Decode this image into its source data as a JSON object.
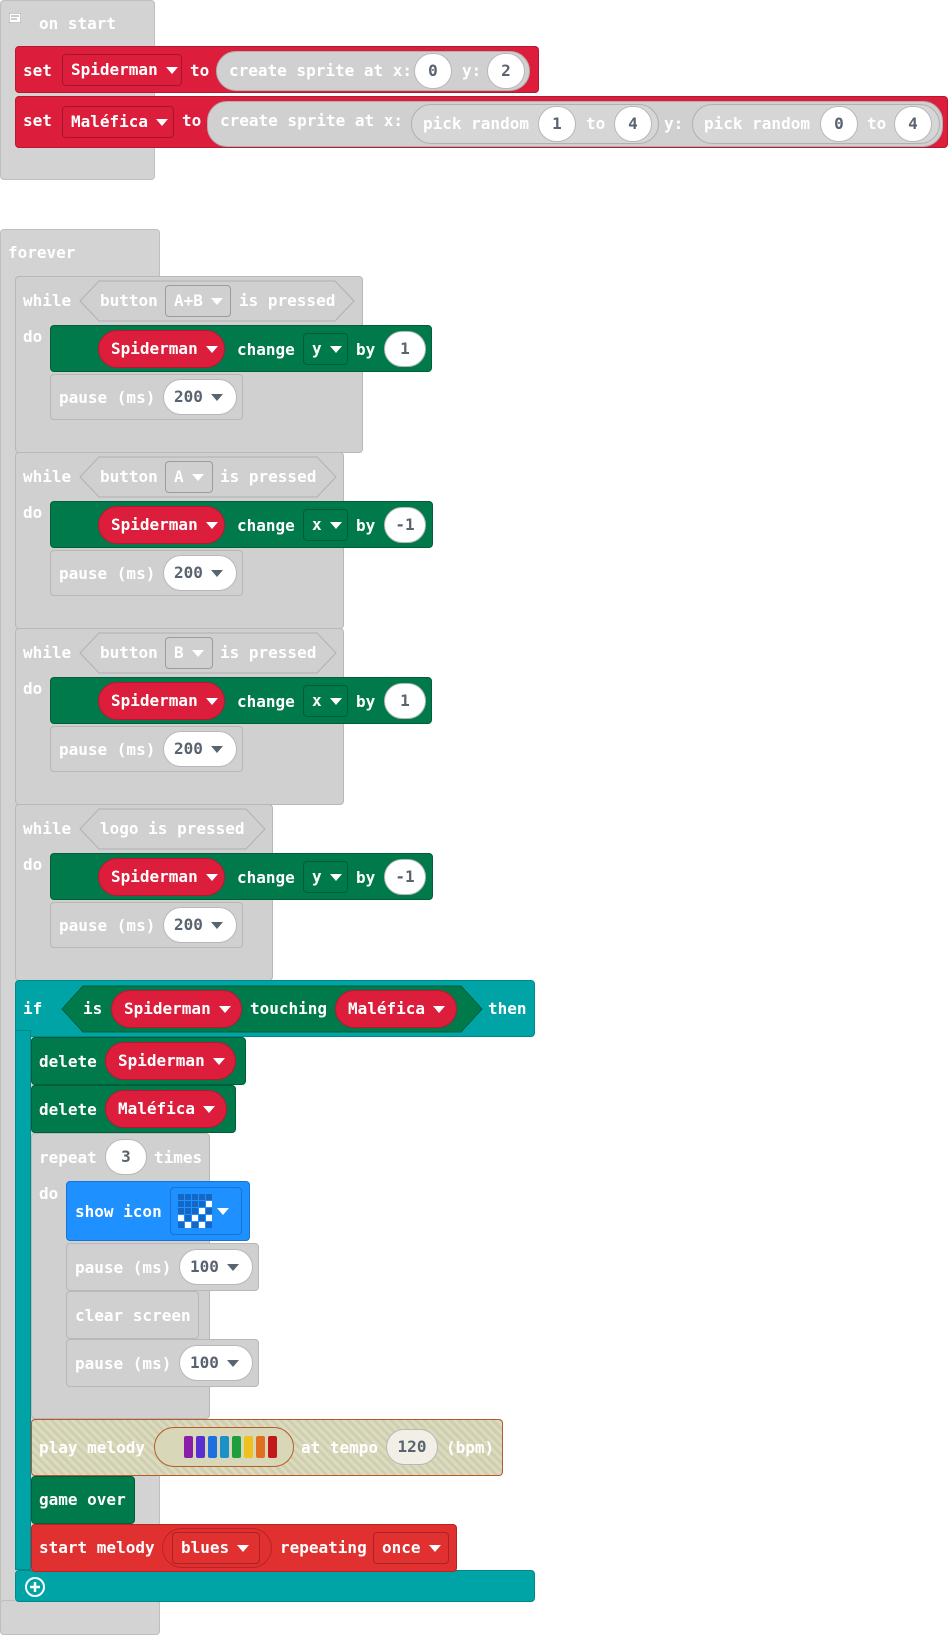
{
  "on_start": {
    "label": "on start",
    "set1": {
      "set": "set",
      "var": "Spiderman",
      "to": "to",
      "create": "create sprite at x:",
      "x": "0",
      "y_label": "y:",
      "y": "2"
    },
    "set2": {
      "set": "set",
      "var": "Maléfica",
      "to": "to",
      "create": "create sprite at x:",
      "pick1": "pick random",
      "p1a": "1",
      "p1to": "to",
      "p1b": "4",
      "y_label": "y:",
      "pick2": "pick random",
      "p2a": "0",
      "p2to": "to",
      "p2b": "4"
    }
  },
  "forever": {
    "label": "forever",
    "while_loops": [
      {
        "while": "while",
        "do": "do",
        "cond_pre": "button",
        "button": "A+B",
        "cond_post": "is pressed",
        "sprite": "Spiderman",
        "change": "change",
        "axis": "y",
        "by": "by",
        "delta": "1",
        "pause": "pause (ms)",
        "ms": "200"
      },
      {
        "while": "while",
        "do": "do",
        "cond_pre": "button",
        "button": "A",
        "cond_post": "is pressed",
        "sprite": "Spiderman",
        "change": "change",
        "axis": "x",
        "by": "by",
        "delta": "-1",
        "pause": "pause (ms)",
        "ms": "200"
      },
      {
        "while": "while",
        "do": "do",
        "cond_pre": "button",
        "button": "B",
        "cond_post": "is pressed",
        "sprite": "Spiderman",
        "change": "change",
        "axis": "x",
        "by": "by",
        "delta": "1",
        "pause": "pause (ms)",
        "ms": "200"
      },
      {
        "while": "while",
        "do": "do",
        "cond_pre": "logo is pressed",
        "button": "",
        "cond_post": "",
        "sprite": "Spiderman",
        "change": "change",
        "axis": "y",
        "by": "by",
        "delta": "-1",
        "pause": "pause (ms)",
        "ms": "200"
      }
    ],
    "if_block": {
      "if": "if",
      "is": "is",
      "sprite_a": "Spiderman",
      "touching": "touching",
      "sprite_b": "Maléfica",
      "then": "then",
      "delete1": "delete",
      "delete1_sprite": "Spiderman",
      "delete2": "delete",
      "delete2_sprite": "Maléfica",
      "repeat": "repeat",
      "repeat_count": "3",
      "times": "times",
      "do": "do",
      "show_icon": "show icon",
      "pause1": "pause (ms)",
      "pause1_ms": "100",
      "clear": "clear screen",
      "pause2": "pause (ms)",
      "pause2_ms": "100",
      "play_melody": "play melody",
      "at_tempo": "at tempo",
      "tempo": "120",
      "bpm": "(bpm)",
      "melody_colors": [
        "#8a1ea8",
        "#5a2fd0",
        "#1e6fe0",
        "#1e90c8",
        "#1e9e3c",
        "#f0c020",
        "#e07020",
        "#c01a1a"
      ],
      "game_over": "game over",
      "start_melody": "start melody",
      "melody_name": "blues",
      "repeating": "repeating",
      "repeat_mode": "once"
    }
  },
  "colors": {
    "loops": "#d0d0d0",
    "sprites": "#dc1e3c",
    "actions": "#007a4b",
    "logic": "#00a4a6",
    "basic": "#1e90ff",
    "music": "#e03030"
  }
}
